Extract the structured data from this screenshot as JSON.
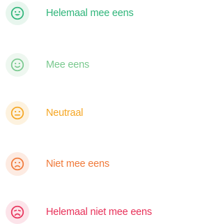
{
  "options": [
    {
      "label": "Helemaal mee eens",
      "icon": "very-happy-face-icon",
      "color": "#2fb57a",
      "bg": "#e8f6ee"
    },
    {
      "label": "Mee eens",
      "icon": "happy-face-icon",
      "color": "#7ac98f",
      "bg": "#eef7f0"
    },
    {
      "label": "Neutraal",
      "icon": "neutral-face-icon",
      "color": "#f5a623",
      "bg": "#fdf2df"
    },
    {
      "label": "Niet mee eens",
      "icon": "sad-face-icon",
      "color": "#f07a3a",
      "bg": "#fdebe2"
    },
    {
      "label": "Helemaal niet mee eens",
      "icon": "very-sad-face-icon",
      "color": "#e8325a",
      "bg": "#fce4ea"
    }
  ]
}
